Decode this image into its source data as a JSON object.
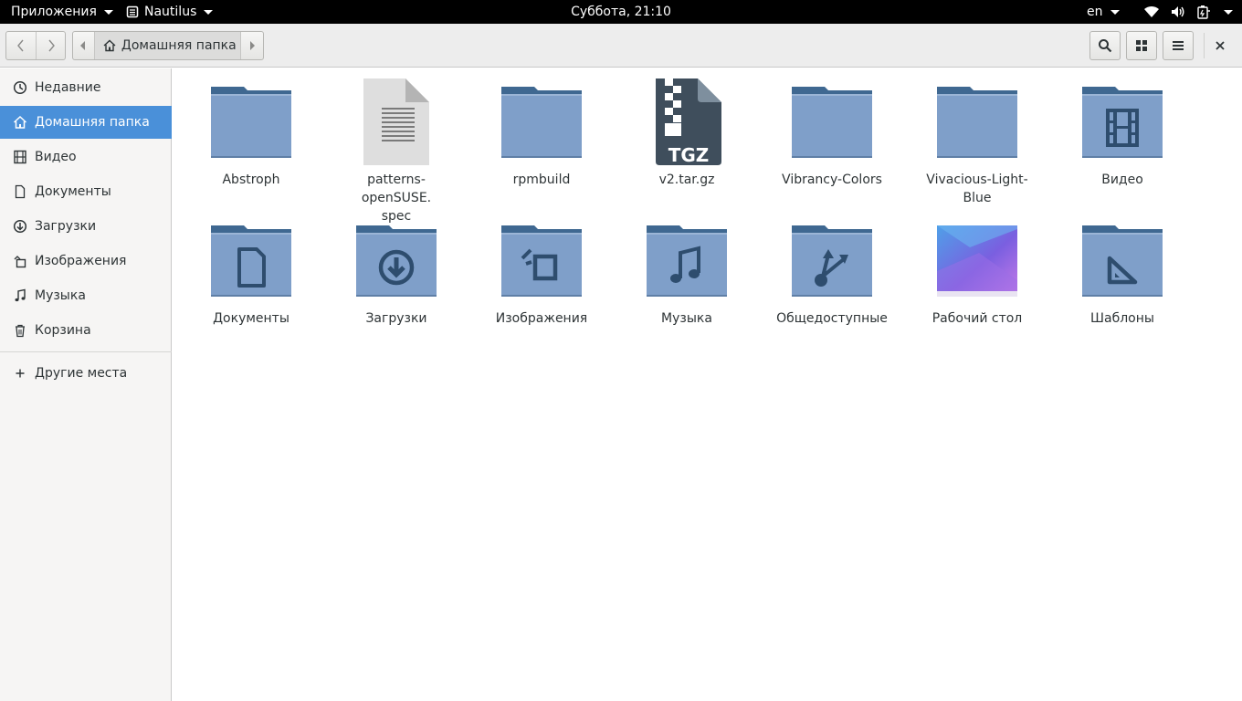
{
  "topbar": {
    "apps_label": "Приложения",
    "app_name": "Nautilus",
    "clock": "Суббота, 21:10",
    "lang": "en"
  },
  "headerbar": {
    "path_home": "Домашняя папка"
  },
  "sidebar": {
    "items": [
      {
        "label": "Недавние",
        "icon": "clock-icon"
      },
      {
        "label": "Домашняя папка",
        "icon": "home-icon"
      },
      {
        "label": "Видео",
        "icon": "film-icon"
      },
      {
        "label": "Документы",
        "icon": "document-icon"
      },
      {
        "label": "Загрузки",
        "icon": "download-icon"
      },
      {
        "label": "Изображения",
        "icon": "image-icon"
      },
      {
        "label": "Музыка",
        "icon": "music-icon"
      },
      {
        "label": "Корзина",
        "icon": "trash-icon"
      }
    ],
    "other_places": "Другие места"
  },
  "files": [
    {
      "name": "Abstroph",
      "type": "folder"
    },
    {
      "name": "patterns-openSUSE.\nspec",
      "type": "text"
    },
    {
      "name": "rpmbuild",
      "type": "folder"
    },
    {
      "name": "v2.tar.gz",
      "type": "archive",
      "badge": "TGZ"
    },
    {
      "name": "Vibrancy-Colors",
      "type": "folder"
    },
    {
      "name": "Vivacious-Light-Blue",
      "type": "folder"
    },
    {
      "name": "Видео",
      "type": "folder-video"
    },
    {
      "name": "Документы",
      "type": "folder-documents"
    },
    {
      "name": "Загрузки",
      "type": "folder-download"
    },
    {
      "name": "Изображения",
      "type": "folder-pictures"
    },
    {
      "name": "Музыка",
      "type": "folder-music"
    },
    {
      "name": "Общедоступные",
      "type": "folder-public"
    },
    {
      "name": "Рабочий стол",
      "type": "desktop"
    },
    {
      "name": "Шаблоны",
      "type": "folder-templates"
    }
  ],
  "colors": {
    "accent": "#4a90d9",
    "folder_body": "#7f9fc9",
    "folder_tab": "#3f6891",
    "folder_glyph": "#2e4d6e"
  }
}
